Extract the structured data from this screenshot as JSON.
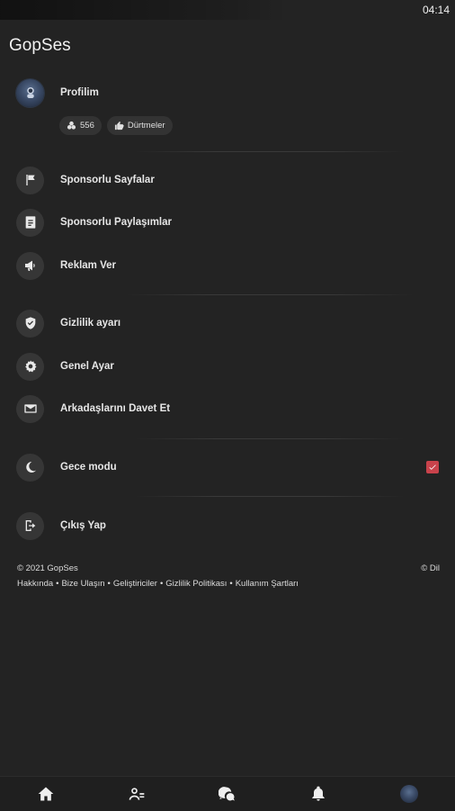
{
  "status_bar": {
    "time": "04:14"
  },
  "app": {
    "title": "GopSes"
  },
  "profile": {
    "label": "Profilim",
    "points": "556",
    "pokes_label": "Dürtmeler"
  },
  "menu_group_1": [
    {
      "label": "Sponsorlu Sayfalar",
      "icon": "flag-icon"
    },
    {
      "label": "Sponsorlu Paylaşımlar",
      "icon": "post-icon"
    },
    {
      "label": "Reklam Ver",
      "icon": "megaphone-icon"
    }
  ],
  "menu_group_2": [
    {
      "label": "Gizlilik ayarı",
      "icon": "shield-icon"
    },
    {
      "label": "Genel Ayar",
      "icon": "gear-icon"
    },
    {
      "label": "Arkadaşlarını Davet Et",
      "icon": "mail-icon"
    }
  ],
  "night_mode": {
    "label": "Gece modu",
    "checked": true,
    "accent": "#c8424b"
  },
  "logout": {
    "label": "Çıkış Yap"
  },
  "footer": {
    "copyright": "© 2021 GopSes",
    "language": "Dil",
    "links": [
      "Hakkında",
      "Bize Ulaşın",
      "Geliştiriciler",
      "Gizlilik Politikası",
      "Kullanım Şartları"
    ],
    "separator": "•"
  },
  "bottom_nav": [
    "home-icon",
    "friends-icon",
    "chat-icon",
    "bell-icon",
    "avatar"
  ]
}
